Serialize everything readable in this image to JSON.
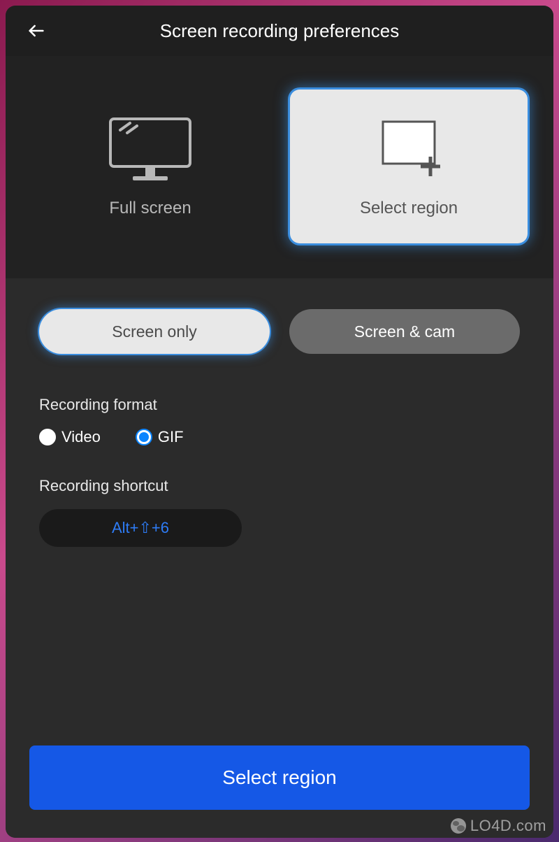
{
  "header": {
    "title": "Screen recording preferences"
  },
  "capture_modes": {
    "full_screen": {
      "label": "Full screen",
      "selected": false
    },
    "select_region": {
      "label": "Select region",
      "selected": true
    }
  },
  "source_modes": {
    "screen_only": {
      "label": "Screen only",
      "selected": true
    },
    "screen_cam": {
      "label": "Screen & cam",
      "selected": false
    }
  },
  "recording_format": {
    "label": "Recording format",
    "options": {
      "video": {
        "label": "Video",
        "selected": false
      },
      "gif": {
        "label": "GIF",
        "selected": true
      }
    }
  },
  "recording_shortcut": {
    "label": "Recording shortcut",
    "value": "Alt+⇧+6"
  },
  "primary_action": {
    "label": "Select region"
  },
  "watermark": "LO4D.com"
}
